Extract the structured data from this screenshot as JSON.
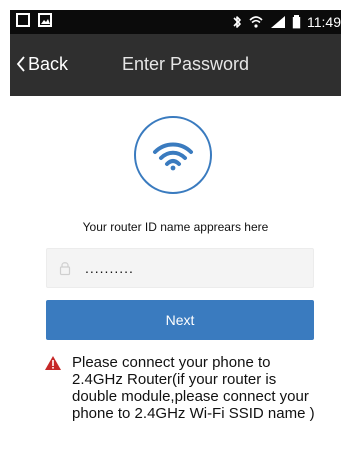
{
  "status_bar": {
    "time": "11:49"
  },
  "nav": {
    "back_label": "Back",
    "title": "Enter Password"
  },
  "main": {
    "router_id_text": "Your router ID name apprears here",
    "password_value": "..........",
    "next_label": "Next",
    "warning_text": "Please connect your phone to 2.4GHz Router(if your router is double module,please connect your phone to 2.4GHz Wi-Fi SSID name )"
  },
  "colors": {
    "accent": "#3a7bbf",
    "nav_bg": "#2f2f2f",
    "status_bg": "#0b0b0b",
    "warning": "#c62828"
  },
  "icons": {
    "status_left": [
      "notification-box-icon",
      "image-icon"
    ],
    "status_right": [
      "bluetooth-icon",
      "wifi-signal-icon",
      "cell-signal-icon",
      "battery-icon"
    ],
    "nav_back": "chevron-left-icon",
    "hero": "wifi-icon",
    "password": "lock-icon",
    "warning": "warning-triangle-icon"
  }
}
